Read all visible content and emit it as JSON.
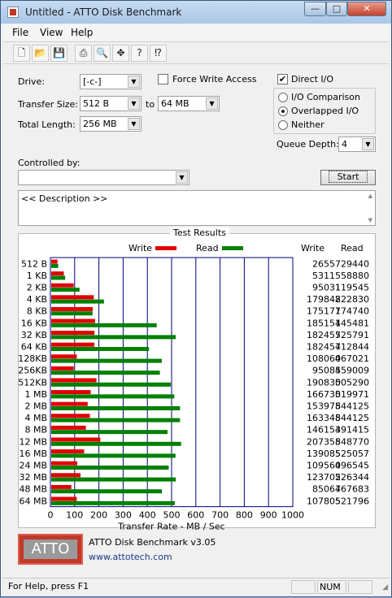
{
  "window": {
    "title": "Untitled - ATTO Disk Benchmark"
  },
  "titlebar_buttons": {
    "minimize": "—",
    "maximize": "□",
    "close": "✕"
  },
  "menu": {
    "items": [
      "File",
      "View",
      "Help"
    ]
  },
  "toolbar": {
    "icons": [
      "new-icon",
      "open-icon",
      "save-icon",
      "print-icon",
      "print-preview-icon",
      "move-icon",
      "help-icon",
      "context-help-icon"
    ]
  },
  "settings": {
    "drive_label": "Drive:",
    "drive_value": "[-c-]",
    "force_write_access_label": "Force Write Access",
    "force_write_access_checked": false,
    "direct_io_label": "Direct I/O",
    "direct_io_checked": true,
    "transfer_size_label": "Transfer Size:",
    "transfer_size_from": "512 B",
    "to_label": "to",
    "transfer_size_to": "64 MB",
    "total_length_label": "Total Length:",
    "total_length_value": "256 MB",
    "io_options": [
      "I/O Comparison",
      "Overlapped I/O",
      "Neither"
    ],
    "io_selected": "Overlapped I/O",
    "queue_depth_label": "Queue Depth:",
    "queue_depth_value": "4",
    "controlled_by_label": "Controlled by:",
    "controlled_by_value": "",
    "start_label": "Start",
    "description_text": "<< Description >>"
  },
  "results": {
    "title": "Test Results",
    "legend_write": "Write",
    "legend_read": "Read",
    "col_write": "Write",
    "col_read": "Read",
    "write_color": "#e00000",
    "read_color": "#008000"
  },
  "chart_data": {
    "type": "bar",
    "orientation": "horizontal",
    "title": "Test Results",
    "xlabel": "Transfer Rate - MB / Sec",
    "xlim": [
      0,
      1000
    ],
    "xticks": [
      0,
      100,
      200,
      300,
      400,
      500,
      600,
      700,
      800,
      900,
      1000
    ],
    "legend_placement": "top",
    "categories": [
      "512 B",
      "1 KB",
      "2 KB",
      "4 KB",
      "8 KB",
      "16 KB",
      "32 KB",
      "64 KB",
      "128KB",
      "256KB",
      "512KB",
      "1 MB",
      "2 MB",
      "4 MB",
      "8 MB",
      "12 MB",
      "16 MB",
      "24 MB",
      "32 MB",
      "48 MB",
      "64 MB"
    ],
    "series": [
      {
        "name": "Write",
        "color": "#e00000",
        "values": [
          26557,
          53115,
          95031,
          179848,
          175177,
          185151,
          182457,
          182457,
          108060,
          95085,
          190830,
          166730,
          153978,
          163348,
          146153,
          207358,
          139085,
          109560,
          123702,
          85067,
          107805
        ]
      },
      {
        "name": "Read",
        "color": "#008000",
        "values": [
          29440,
          58880,
          119545,
          222830,
          174740,
          445481,
          525791,
          412844,
          467021,
          459009,
          505290,
          519971,
          544125,
          544125,
          491415,
          548770,
          525057,
          496545,
          526344,
          467683,
          521796
        ]
      }
    ],
    "units_note": "Write/Read columns are KB/sec; bars are plotted in MB/sec"
  },
  "footer": {
    "logo_text": "ATTO",
    "product": "ATTO Disk Benchmark v3.05",
    "url": "www.attotech.com"
  },
  "statusbar": {
    "text": "For Help, press F1",
    "num": "NUM"
  }
}
